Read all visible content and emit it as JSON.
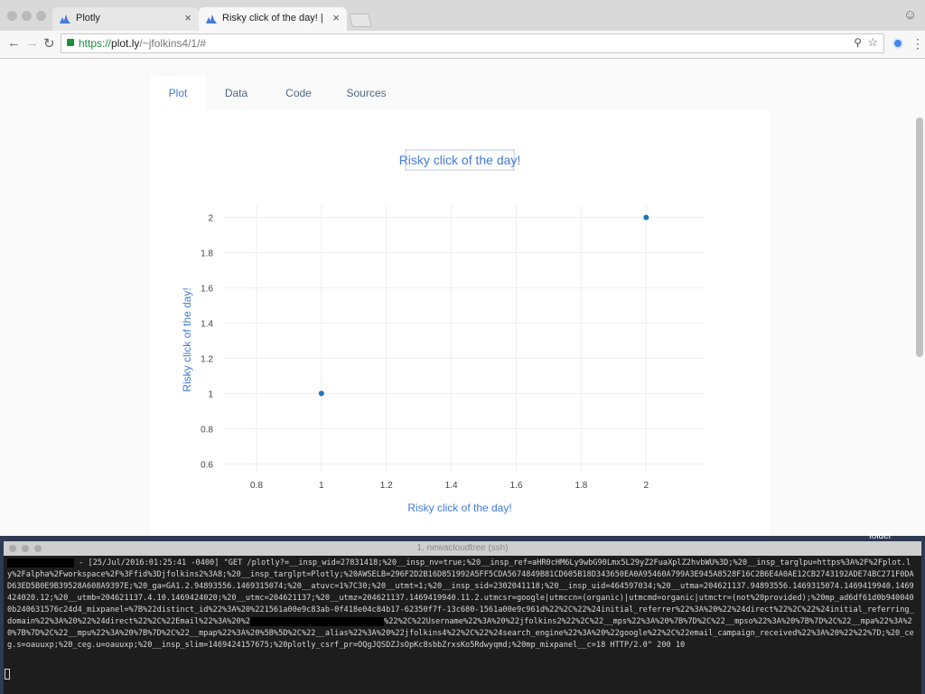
{
  "browser": {
    "tabs": [
      {
        "title": "Plotly",
        "close": "×"
      },
      {
        "title": "Risky click of the day! | scatter",
        "close": "×"
      }
    ],
    "url": {
      "scheme": "https://",
      "host": "plot.ly",
      "path": "/~jfolkins4/1/#"
    }
  },
  "plot_page": {
    "tabs": [
      "Plot",
      "Data",
      "Code",
      "Sources"
    ],
    "active_tab": "Plot"
  },
  "chart_data": {
    "type": "scatter",
    "title": "Risky click of the day!",
    "xlabel": "Risky click of the day!",
    "ylabel": "Risky click of the day!",
    "x": [
      1,
      2
    ],
    "y": [
      1,
      2
    ],
    "xlim": [
      0.7,
      2.18
    ],
    "ylim": [
      0.55,
      2.07
    ],
    "xticks": [
      0.8,
      1,
      1.2,
      1.4,
      1.6,
      1.8,
      2
    ],
    "yticks": [
      0.6,
      0.8,
      1,
      1.2,
      1.4,
      1.6,
      1.8,
      2
    ],
    "xtick_labels": [
      "0.8",
      "1",
      "1.2",
      "1.4",
      "1.6",
      "1.8",
      "2"
    ],
    "ytick_labels": [
      "0.6",
      "0.8",
      "1",
      "1.2",
      "1.4",
      "1.6",
      "1.8",
      "2"
    ],
    "grid": true,
    "marker_color": "#1f77b4",
    "text_color": "#447adb"
  },
  "terminal": {
    "title": "1. newacloudtree (ssh)",
    "log_after_redaction_1": " - [25/Jul/2016:01:25:41 -0400] \"GET /plotly?=__insp_wid=27831418;%20__insp_nv=true;%20__insp_ref=aHR0cHM6Ly9wbG90Lmx5L29yZ2FuaXplZ2hvbWU%3D;%20__insp_targlpu=https%3A%2F%2Fplot.ly%2Falpha%2Fworkspace%2F%3Ffid%3Djfolkins2%3A8;%20__insp_targlpt=Plotly;%20AWSELB=296F2D2B16D851992A5FF5CDA5674849B81CD605B18D343650EA0A95460A799A3E945A8528F16C2B6E4A0AE12CB2743192ADE74BC271F0DAD63ED5B0E9B39528A608A9397E;%20_ga=GA1.2.94893556.1469315074;%20__atuvc=1%7C30;%20__utmt=1;%20__insp_sid=2302041118;%20__insp_uid=464597034;%20__utma=204621137.94893556.1469315074.1469419940.1469424020.12;%20__utmb=204621137.4.10.1469424020;%20__utmc=204621137;%20__utmz=204621137.1469419940.11.2.utmcsr=google|utmccn=(organic)|utmcmd=organic|utmctr=(not%20provided);%20mp_ad6df61d0b9400400b240631576c24d4_mixpanel=%7B%22distinct_id%22%3A%20%221561a00e9c83ab-0f418e04c84b17-62350f7f-13c680-1561a00e9c961d%22%2C%22%24initial_referrer%22%3A%20%22%24direct%22%2C%22%24initial_referring_domain%22%3A%20%22%24direct%22%2C%22Email%22%3A%20%2",
    "log_after_redaction_2": "%22%2C%22Username%22%3A%20%22jfolkins2%22%2C%22__mps%22%3A%20%7B%7D%2C%22__mpso%22%3A%20%7B%7D%2C%22__mpa%22%3A%20%7B%7D%2C%22__mpu%22%3A%20%7B%7D%2C%22__mpap%22%3A%20%5B%5D%2C%22__alias%22%3A%20%22jfolkins4%22%2C%22%24search_engine%22%3A%20%22google%22%2C%22email_campaign_received%22%3A%20%22%22%7D;%20_ceg.s=oauuxp;%20_ceg.u=oauuxp;%20__insp_slim=1469424157675;%20plotly_csrf_pr=OQgJQSDZJsOpKc8sbbZrxsKo5Rdwyqmd;%20mp_mixpanel__c=18 HTTP/2.0\" 200 10"
  },
  "desktop": {
    "icon_label": "folder"
  }
}
